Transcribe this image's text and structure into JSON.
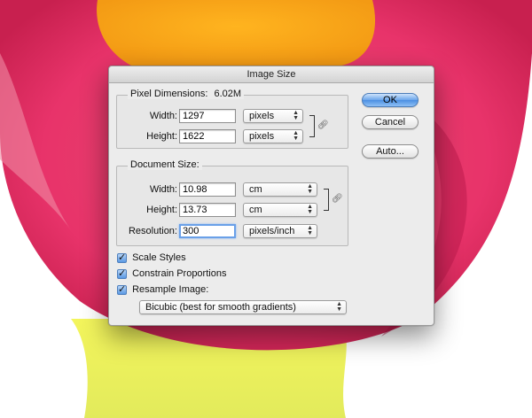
{
  "dialog": {
    "title": "Image Size"
  },
  "pixel_dimensions": {
    "label": "Pixel Dimensions:",
    "size": "6.02M",
    "width_label": "Width:",
    "width_value": "1297",
    "width_unit": "pixels",
    "height_label": "Height:",
    "height_value": "1622",
    "height_unit": "pixels"
  },
  "document_size": {
    "label": "Document Size:",
    "width_label": "Width:",
    "width_value": "10.98",
    "width_unit": "cm",
    "height_label": "Height:",
    "height_value": "13.73",
    "height_unit": "cm",
    "resolution_label": "Resolution:",
    "resolution_value": "300",
    "resolution_unit": "pixels/inch"
  },
  "buttons": {
    "ok": "OK",
    "cancel": "Cancel",
    "auto": "Auto..."
  },
  "options": {
    "scale_styles": {
      "label": "Scale Styles",
      "checked": true
    },
    "constrain_proportions": {
      "label": "Constrain Proportions",
      "checked": true
    },
    "resample_image": {
      "label": "Resample Image:",
      "checked": true
    },
    "resample_method": "Bicubic (best for smooth gradients)"
  },
  "icons": {
    "link": "chain-link-icon",
    "select_arrows": "up-down-arrows-icon"
  },
  "colors": {
    "default_button": "#4a8fe2",
    "artwork_pink": "#e8336a",
    "artwork_orange": "#f7a21a",
    "artwork_yellow": "#eef23a"
  }
}
